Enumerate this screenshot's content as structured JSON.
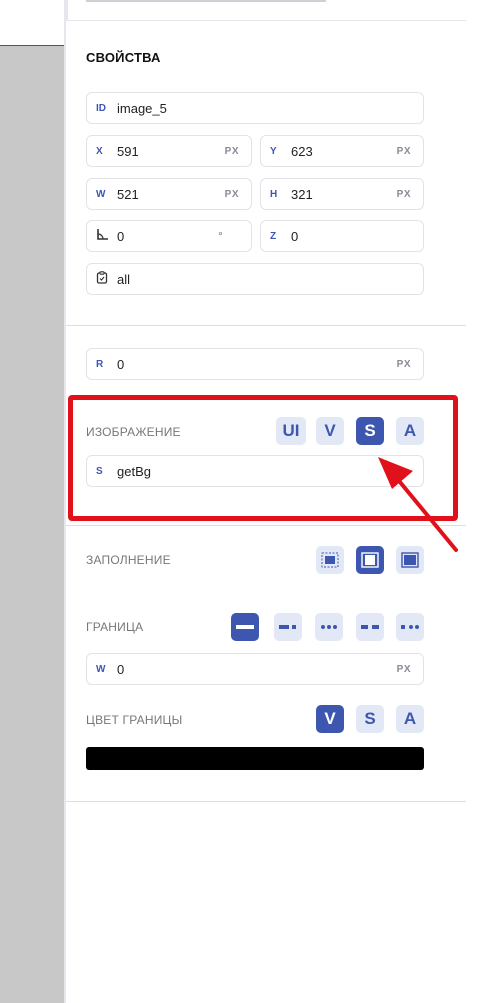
{
  "properties": {
    "title": "СВОЙСТВА",
    "id": {
      "label": "ID",
      "value": "image_5"
    },
    "x": {
      "label": "X",
      "value": "591",
      "unit": "PX"
    },
    "y": {
      "label": "Y",
      "value": "623",
      "unit": "PX"
    },
    "w": {
      "label": "W",
      "value": "521",
      "unit": "PX"
    },
    "h": {
      "label": "H",
      "value": "321",
      "unit": "PX"
    },
    "rotation": {
      "value": "0",
      "unit": "°"
    },
    "z": {
      "label": "Z",
      "value": "0"
    },
    "visibility": {
      "value": "all"
    }
  },
  "radius": {
    "label": "R",
    "value": "0",
    "unit": "PX"
  },
  "image": {
    "title": "ИЗОБРАЖЕНИЕ",
    "modes": [
      "UI",
      "V",
      "S",
      "A"
    ],
    "active_mode": "S",
    "source": {
      "label": "S",
      "value": "getBg"
    }
  },
  "fill": {
    "title": "ЗАПОЛНЕНИЕ",
    "active_option": 2
  },
  "border": {
    "title": "ГРАНИЦА",
    "width": {
      "label": "W",
      "value": "0",
      "unit": "PX"
    },
    "active_style": 1
  },
  "border_color": {
    "title": "ЦВЕТ ГРАНИЦЫ",
    "modes": [
      "V",
      "S",
      "A"
    ],
    "active_mode": "V",
    "color": "#000000"
  },
  "colors": {
    "accent": "#3d57b0",
    "accent_light": "#e3e8f7",
    "highlight": "#e0111a"
  }
}
